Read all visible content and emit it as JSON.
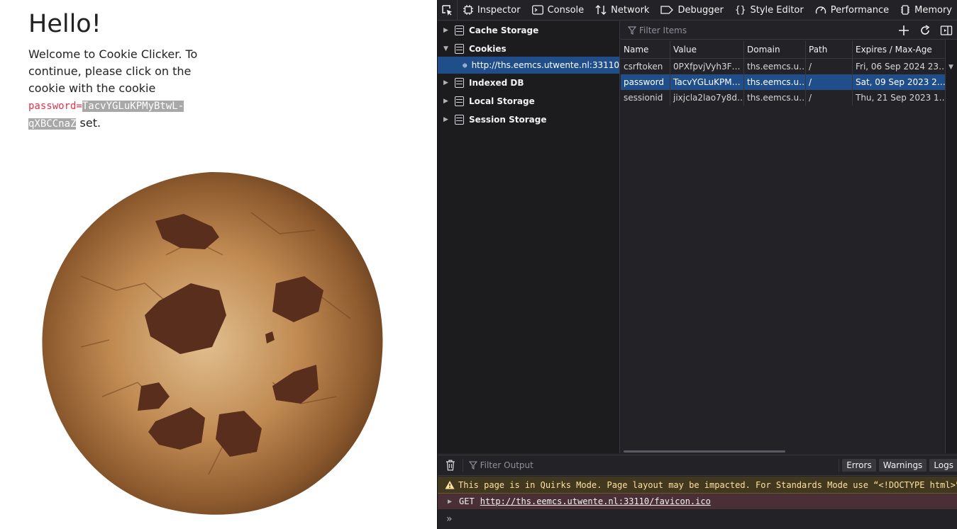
{
  "page": {
    "heading": "Hello!",
    "intro_text": "Welcome to Cookie Clicker. To continue, please click on the cookie with the cookie",
    "code_key": "password=",
    "code_value": "TacvYGLuKPMyBtwL-qXBCCnaZ",
    "suffix": " set."
  },
  "devtools": {
    "tabs": [
      {
        "label": "Inspector",
        "icon": "inspector-icon"
      },
      {
        "label": "Console",
        "icon": "console-icon"
      },
      {
        "label": "Network",
        "icon": "network-icon"
      },
      {
        "label": "Debugger",
        "icon": "debugger-icon"
      },
      {
        "label": "Style Editor",
        "icon": "style-editor-icon"
      },
      {
        "label": "Performance",
        "icon": "performance-icon"
      },
      {
        "label": "Memory",
        "icon": "memory-icon"
      }
    ],
    "tree": {
      "cache_storage": "Cache Storage",
      "cookies": "Cookies",
      "cookies_host": "http://ths.eemcs.utwente.nl:33110",
      "indexed_db": "Indexed DB",
      "local_storage": "Local Storage",
      "session_storage": "Session Storage"
    },
    "filter_placeholder": "Filter Items",
    "table": {
      "columns": [
        "Name",
        "Value",
        "Domain",
        "Path",
        "Expires / Max-Age"
      ],
      "rows": [
        [
          "csrftoken",
          "0PXfpvjVyh3F…",
          "ths.eemcs.u…",
          "/",
          "Fri, 06 Sep 2024 23…"
        ],
        [
          "password",
          "TacvYGLuKPM…",
          "ths.eemcs.u…",
          "/",
          "Sat, 09 Sep 2023 2…"
        ],
        [
          "sessionid",
          "jixjcla2lao7y8d…",
          "ths.eemcs.u…",
          "/",
          "Thu, 21 Sep 2023 1…"
        ]
      ],
      "selected_row": 1
    },
    "console": {
      "filter_placeholder": "Filter Output",
      "chips": [
        "Errors",
        "Warnings",
        "Logs"
      ],
      "warning": "This page is in Quirks Mode. Page layout may be impacted. For Standards Mode use “<!DOCTYPE html>”.",
      "request_method": "GET",
      "request_url": "http://ths.eemcs.utwente.nl:33110/favicon.ico",
      "prompt": "»"
    }
  }
}
